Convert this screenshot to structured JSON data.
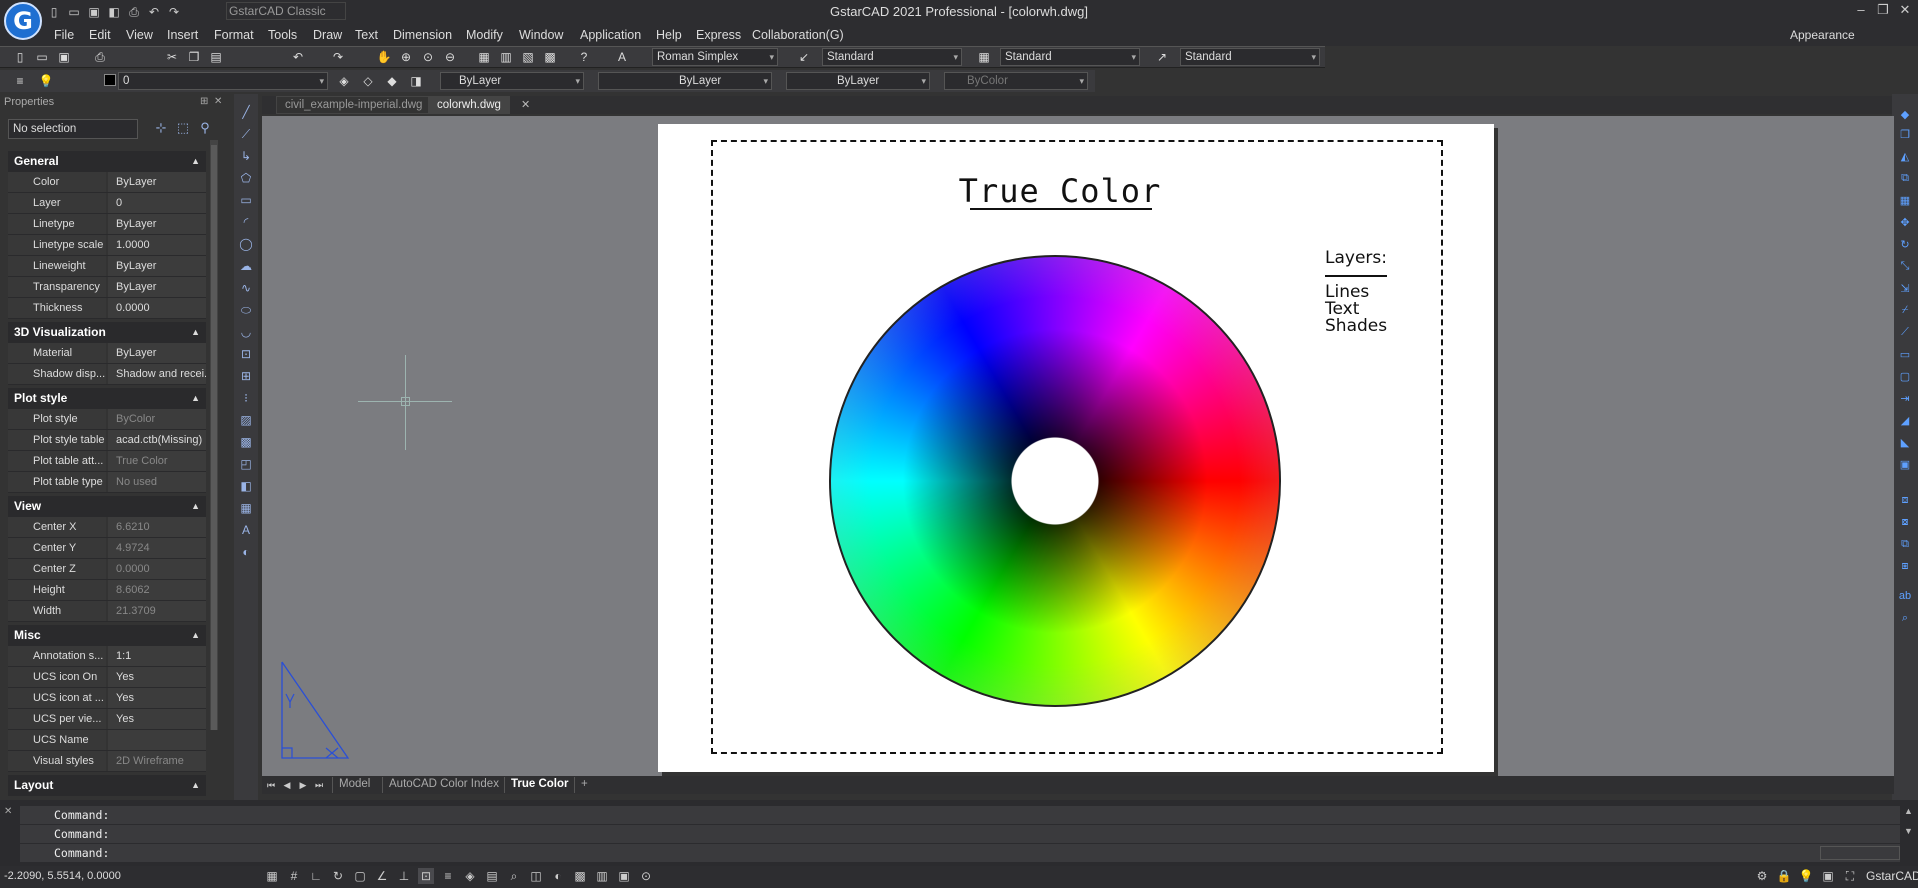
{
  "window": {
    "title": "GstarCAD 2021 Professional - [colorwh.dwg]",
    "logo_letter": "G",
    "workspace": "GstarCAD Classic"
  },
  "menu": [
    "File",
    "Edit",
    "View",
    "Insert",
    "Format",
    "Tools",
    "Draw",
    "Text",
    "Dimension",
    "Modify",
    "Window",
    "Application",
    "Help",
    "Express",
    "Collaboration(G)"
  ],
  "appearance_label": "Appearance",
  "toolbar": {
    "text_style": "Roman Simplex",
    "dim_style": "Standard",
    "table_style": "Standard",
    "multileader_style": "Standard",
    "layer": "0",
    "color": "ByLayer",
    "linetype": "ByLayer",
    "lineweight": "ByLayer",
    "plotstyle": "ByColor"
  },
  "properties": {
    "header": "Properties",
    "selection": "No selection",
    "sections": [
      {
        "title": "General",
        "rows": [
          {
            "k": "Color",
            "v": "ByLayer"
          },
          {
            "k": "Layer",
            "v": "0"
          },
          {
            "k": "Linetype",
            "v": "ByLayer"
          },
          {
            "k": "Linetype scale",
            "v": "1.0000"
          },
          {
            "k": "Lineweight",
            "v": "ByLayer"
          },
          {
            "k": "Transparency",
            "v": "ByLayer"
          },
          {
            "k": "Thickness",
            "v": "0.0000"
          }
        ]
      },
      {
        "title": "3D Visualization",
        "rows": [
          {
            "k": "Material",
            "v": "ByLayer"
          },
          {
            "k": "Shadow disp...",
            "v": "Shadow and recei..."
          }
        ]
      },
      {
        "title": "Plot style",
        "rows": [
          {
            "k": "Plot style",
            "v": "ByColor"
          },
          {
            "k": "Plot style table",
            "v": "acad.ctb(Missing)"
          },
          {
            "k": "Plot table att...",
            "v": "True Color"
          },
          {
            "k": "Plot table type",
            "v": "No used"
          }
        ]
      },
      {
        "title": "View",
        "rows": [
          {
            "k": "Center X",
            "v": "6.6210"
          },
          {
            "k": "Center Y",
            "v": "4.9724"
          },
          {
            "k": "Center Z",
            "v": "0.0000"
          },
          {
            "k": "Height",
            "v": "8.6062"
          },
          {
            "k": "Width",
            "v": "21.3709"
          }
        ]
      },
      {
        "title": "Misc",
        "rows": [
          {
            "k": "Annotation s...",
            "v": "1:1"
          },
          {
            "k": "UCS icon On",
            "v": "Yes"
          },
          {
            "k": "UCS icon at ...",
            "v": "Yes"
          },
          {
            "k": "UCS per vie...",
            "v": "Yes"
          },
          {
            "k": "UCS Name",
            "v": ""
          },
          {
            "k": "Visual styles",
            "v": "2D Wireframe"
          }
        ]
      },
      {
        "title": "Layout",
        "rows": []
      }
    ]
  },
  "doc_tabs": [
    "civil_example-imperial.dwg",
    "colorwh.dwg"
  ],
  "drawing": {
    "title": "True  Color",
    "layers_heading": "Layers:",
    "layers": [
      "Lines",
      "Text",
      "Shades"
    ]
  },
  "layout_tabs": [
    "Model",
    "AutoCAD Color Index",
    "True Color",
    "+"
  ],
  "command_lines": [
    "Command:",
    "Command:",
    "Command:"
  ],
  "status": {
    "coords": "-2.2090, 5.5514, 0.0000",
    "brand": "GstarCAD"
  }
}
